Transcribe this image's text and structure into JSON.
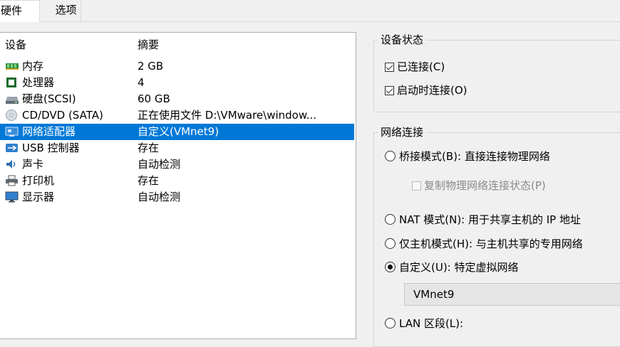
{
  "tabs": [
    {
      "label": "硬件"
    },
    {
      "label": "选项"
    }
  ],
  "device_list": {
    "headers": {
      "device": "设备",
      "summary": "摘要"
    },
    "rows": [
      {
        "icon": "memory-icon",
        "device": "内存",
        "summary": "2 GB"
      },
      {
        "icon": "processor-icon",
        "device": "处理器",
        "summary": "4"
      },
      {
        "icon": "hard-disk-icon",
        "device": "硬盘(SCSI)",
        "summary": "60 GB"
      },
      {
        "icon": "cd-dvd-icon",
        "device": "CD/DVD (SATA)",
        "summary": "正在使用文件 D:\\VMware\\window..."
      },
      {
        "icon": "network-adapter-icon",
        "device": "网络适配器",
        "summary": "自定义(VMnet9)",
        "selected": true
      },
      {
        "icon": "usb-icon",
        "device": "USB 控制器",
        "summary": "存在"
      },
      {
        "icon": "sound-card-icon",
        "device": "声卡",
        "summary": "自动检测"
      },
      {
        "icon": "printer-icon",
        "device": "打印机",
        "summary": "存在"
      },
      {
        "icon": "display-icon",
        "device": "显示器",
        "summary": "自动检测"
      }
    ]
  },
  "device_status": {
    "title": "设备状态",
    "connected": {
      "label": "已连接(C)",
      "checked": true
    },
    "connect_at_power_on": {
      "label": "启动时连接(O)",
      "checked": true
    }
  },
  "network_connection": {
    "title": "网络连接",
    "bridged": {
      "label": "桥接模式(B): 直接连接物理网络",
      "checked": false
    },
    "replicate_state": {
      "label": "复制物理网络连接状态(P)",
      "checked": false,
      "disabled": true
    },
    "nat": {
      "label": "NAT 模式(N): 用于共享主机的 IP 地址",
      "checked": false
    },
    "host_only": {
      "label": "仅主机模式(H): 与主机共享的专用网络",
      "checked": false
    },
    "custom": {
      "label": "自定义(U): 特定虚拟网络",
      "checked": true
    },
    "custom_network_value": "VMnet9",
    "lan_segment": {
      "label": "LAN 区段(L):",
      "checked": false
    }
  },
  "colors": {
    "selection": "#0078d7",
    "window_bg": "#f0f0f0"
  }
}
